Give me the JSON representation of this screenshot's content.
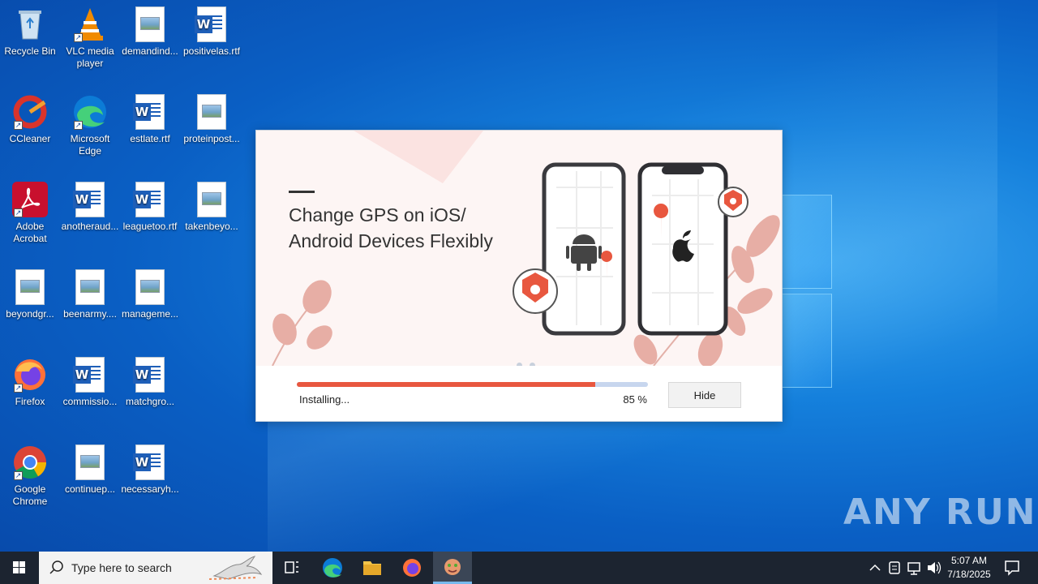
{
  "desktop": {
    "icons": [
      {
        "label": "Recycle Bin",
        "icon": "recycle-bin-icon"
      },
      {
        "label": "VLC media player",
        "icon": "vlc-icon"
      },
      {
        "label": "demandind...",
        "icon": "image-file-icon"
      },
      {
        "label": "positivelas.rtf",
        "icon": "word-document-icon"
      },
      {
        "label": "CCleaner",
        "icon": "ccleaner-icon"
      },
      {
        "label": "Microsoft Edge",
        "icon": "edge-icon"
      },
      {
        "label": "estlate.rtf",
        "icon": "word-document-icon"
      },
      {
        "label": "proteinpost...",
        "icon": "image-file-icon"
      },
      {
        "label": "Adobe Acrobat",
        "icon": "acrobat-icon"
      },
      {
        "label": "anotheraud...",
        "icon": "word-document-icon"
      },
      {
        "label": "leaguetoo.rtf",
        "icon": "word-document-icon"
      },
      {
        "label": "takenbeyo...",
        "icon": "image-file-icon"
      },
      {
        "label": "beyondgr...",
        "icon": "image-file-icon"
      },
      {
        "label": "beenarmy....",
        "icon": "image-file-icon"
      },
      {
        "label": "manageme...",
        "icon": "image-file-icon"
      },
      {
        "label": "Firefox",
        "icon": "firefox-icon"
      },
      {
        "label": "commissio...",
        "icon": "word-document-icon"
      },
      {
        "label": "matchgro...",
        "icon": "word-document-icon"
      },
      {
        "label": "Google Chrome",
        "icon": "chrome-icon"
      },
      {
        "label": "continuep...",
        "icon": "image-file-icon"
      },
      {
        "label": "necessaryh...",
        "icon": "word-document-icon"
      }
    ]
  },
  "installer": {
    "headline_line1": "Change GPS on iOS/",
    "headline_line2": "Android Devices Flexibly",
    "status": "Installing...",
    "progress": 85,
    "progress_label": "85 %",
    "hide_label": "Hide",
    "accent": "#e8573f"
  },
  "watermark": "ANY RUN",
  "taskbar": {
    "search_placeholder": "Type here to search",
    "time": "5:07 AM",
    "date": "7/18/2025"
  }
}
